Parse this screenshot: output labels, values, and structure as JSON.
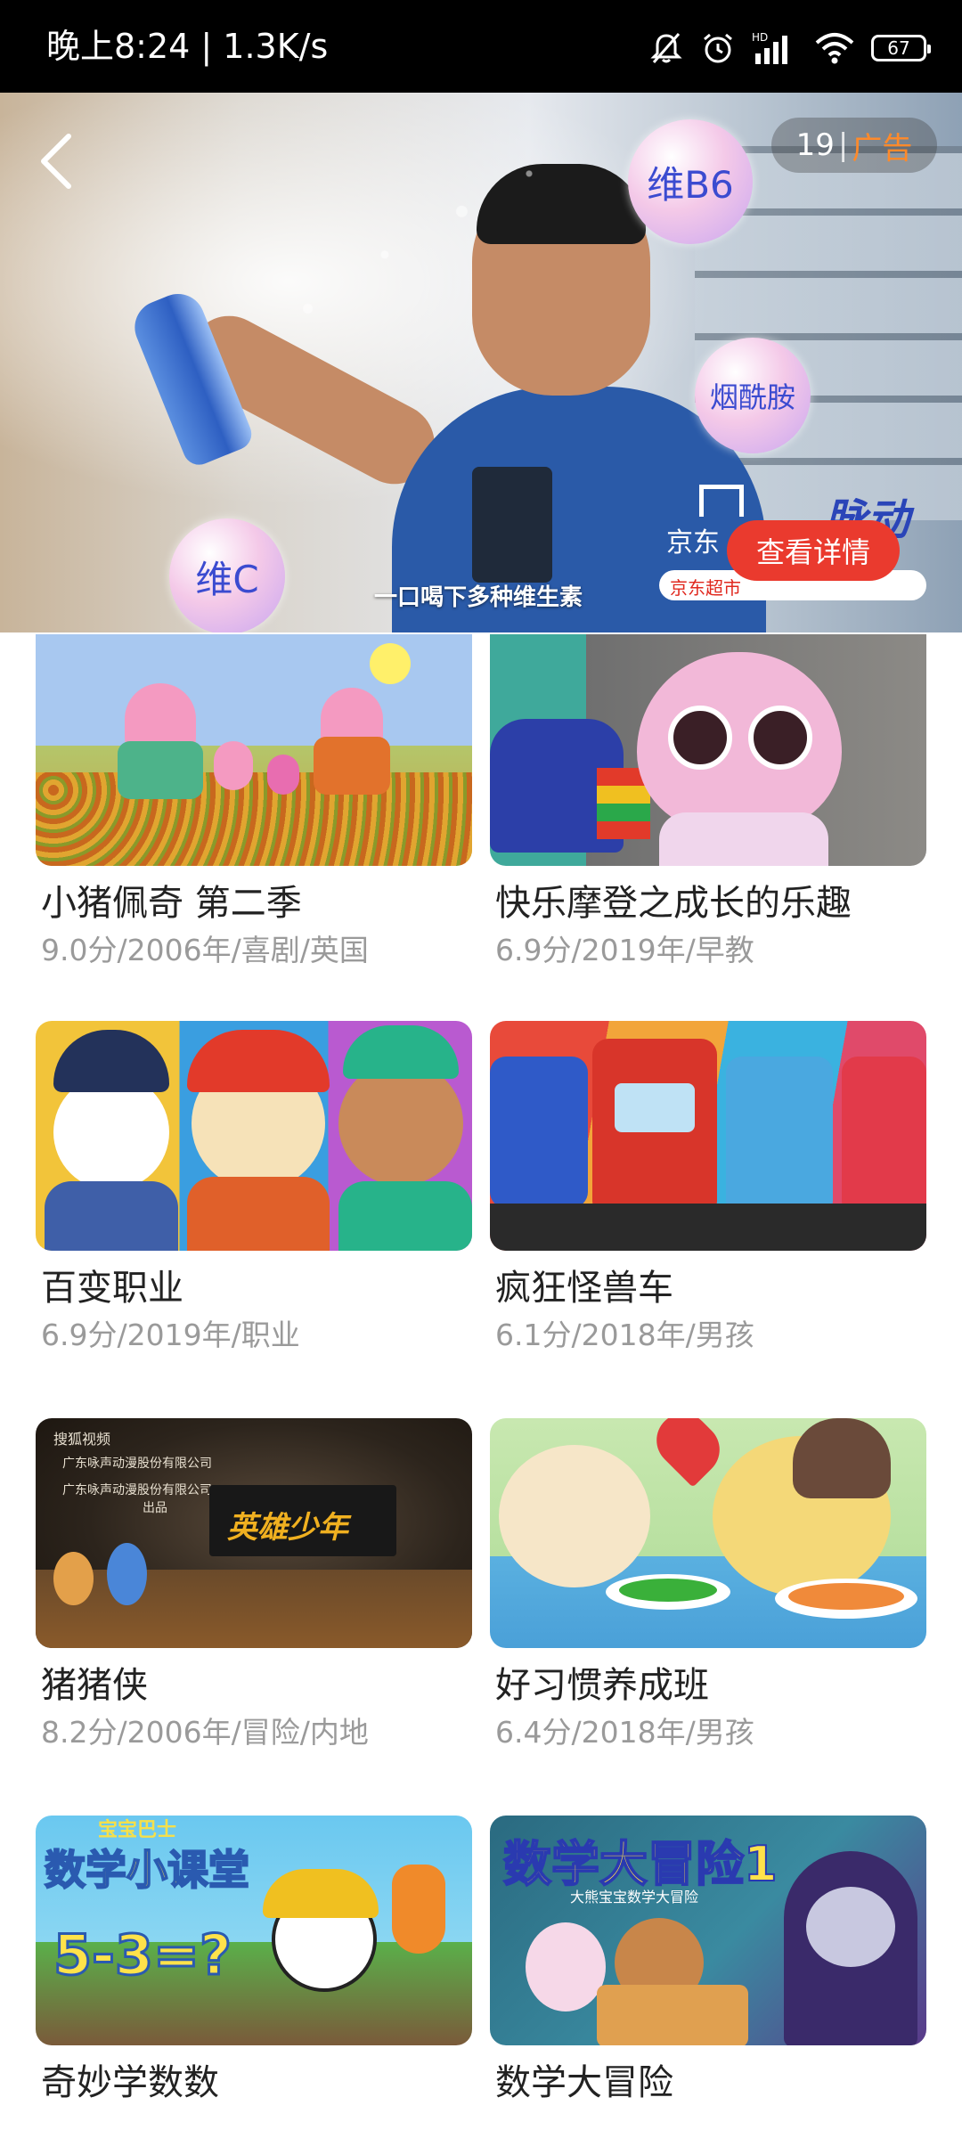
{
  "status_bar": {
    "time_speed": "晚上8:24 | 1.3K/s",
    "battery": "67",
    "network_label": "HD",
    "icons": [
      "mute-icon",
      "alarm-icon",
      "signal-icon",
      "wifi-icon",
      "battery-icon"
    ]
  },
  "ad": {
    "counter": "19",
    "separator": "|",
    "label": "广告",
    "details_button": "查看详情",
    "slogan": "一口喝下多种维生素",
    "bubbles": [
      "维B6",
      "烟酰胺",
      "维C"
    ],
    "brand": "京东",
    "brand2": "脉动",
    "store": "京东超市",
    "accent_color": "#ff8a2a",
    "button_color": "#ea3a2e"
  },
  "shows": [
    {
      "title": "小猪佩奇 第二季",
      "meta": "9.0分/2006年/喜剧/英国"
    },
    {
      "title": "快乐摩登之成长的乐趣",
      "meta": "6.9分/2019年/早教"
    },
    {
      "title": "百变职业",
      "meta": "6.9分/2019年/职业"
    },
    {
      "title": "疯狂怪兽车",
      "meta": "6.1分/2018年/男孩"
    },
    {
      "title": "猪猪侠",
      "meta": "8.2分/2006年/冒险/内地"
    },
    {
      "title": "好习惯养成班",
      "meta": "6.4分/2018年/男孩"
    },
    {
      "title": "奇妙学数数",
      "meta": ""
    },
    {
      "title": "数学大冒险",
      "meta": ""
    }
  ],
  "thumb_text": {
    "zzx_company": "广东咏声动漫股份有限公司",
    "zzx_company2": "广东咏声动漫股份有限公司",
    "zzx_produced": "出品",
    "zzx_logo": "搜狐视频",
    "zzx_title": "英雄少年",
    "math_brand": "宝宝巴士",
    "math_title": "数学小课堂",
    "math_equation": "5-3=?",
    "adv_title": "数学大冒险1",
    "adv_sub": "大熊宝宝数学大冒险"
  }
}
